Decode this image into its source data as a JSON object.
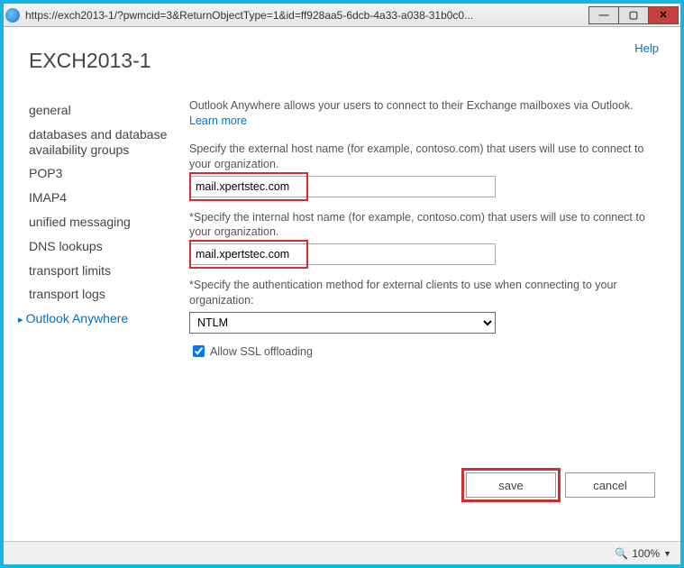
{
  "window": {
    "url": "https://exch2013-1/?pwmcid=3&ReturnObjectType=1&id=ff928aa5-6dcb-4a33-a038-31b0c0..."
  },
  "header": {
    "help": "Help",
    "server": "EXCH2013-1"
  },
  "sidebar": {
    "items": [
      {
        "label": "general"
      },
      {
        "label": "databases and database availability groups"
      },
      {
        "label": "POP3"
      },
      {
        "label": "IMAP4"
      },
      {
        "label": "unified messaging"
      },
      {
        "label": "DNS lookups"
      },
      {
        "label": "transport limits"
      },
      {
        "label": "transport logs"
      },
      {
        "label": "Outlook Anywhere",
        "active": true
      }
    ]
  },
  "main": {
    "intro": "Outlook Anywhere allows your users to connect to their Exchange mailboxes via Outlook. ",
    "learn_more": "Learn more",
    "external_label": "Specify the external host name (for example, contoso.com) that users will use to connect to your organization.",
    "external_value": "mail.xpertstec.com",
    "internal_label": "*Specify the internal host name (for example, contoso.com) that users will use to connect to your organization.",
    "internal_value": "mail.xpertstec.com",
    "auth_label": "*Specify the authentication method for external clients to use when connecting to your organization:",
    "auth_value": "NTLM",
    "ssl_label": "Allow SSL offloading",
    "ssl_checked": true
  },
  "footer": {
    "save": "save",
    "cancel": "cancel"
  },
  "status": {
    "zoom": "100%"
  }
}
